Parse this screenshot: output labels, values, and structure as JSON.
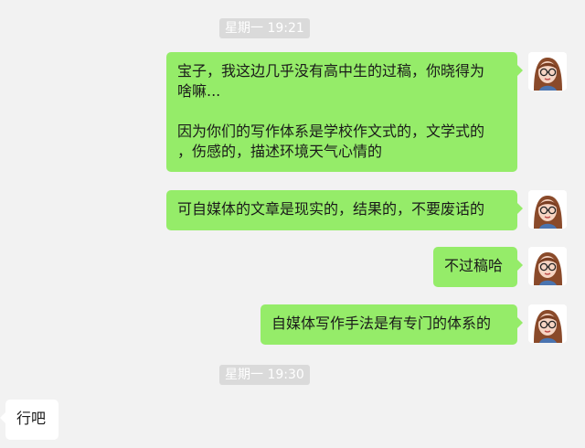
{
  "timestamps": [
    "星期一 19:21",
    "星期一 19:30"
  ],
  "messages": [
    {
      "side": "right",
      "lines": [
        "宝子，我这边几乎没有高中生的过稿，你晓得为",
        "啥嘛...",
        "",
        "因为你们的写作体系是学校作文式的，文学式的",
        "，伤感的，描述环境天气心情的"
      ]
    },
    {
      "side": "right",
      "text": "可自媒体的文章是现实的，结果的，不要废话的"
    },
    {
      "side": "right",
      "text": "不过稿哈"
    },
    {
      "side": "right",
      "text": "自媒体写作手法是有专门的体系的"
    },
    {
      "side": "left",
      "text": "行吧"
    }
  ],
  "colors": {
    "sent_bubble": "#95ec69",
    "received_bubble": "#ffffff",
    "background": "#f2f2f2",
    "timestamp_bg": "#dadada"
  }
}
